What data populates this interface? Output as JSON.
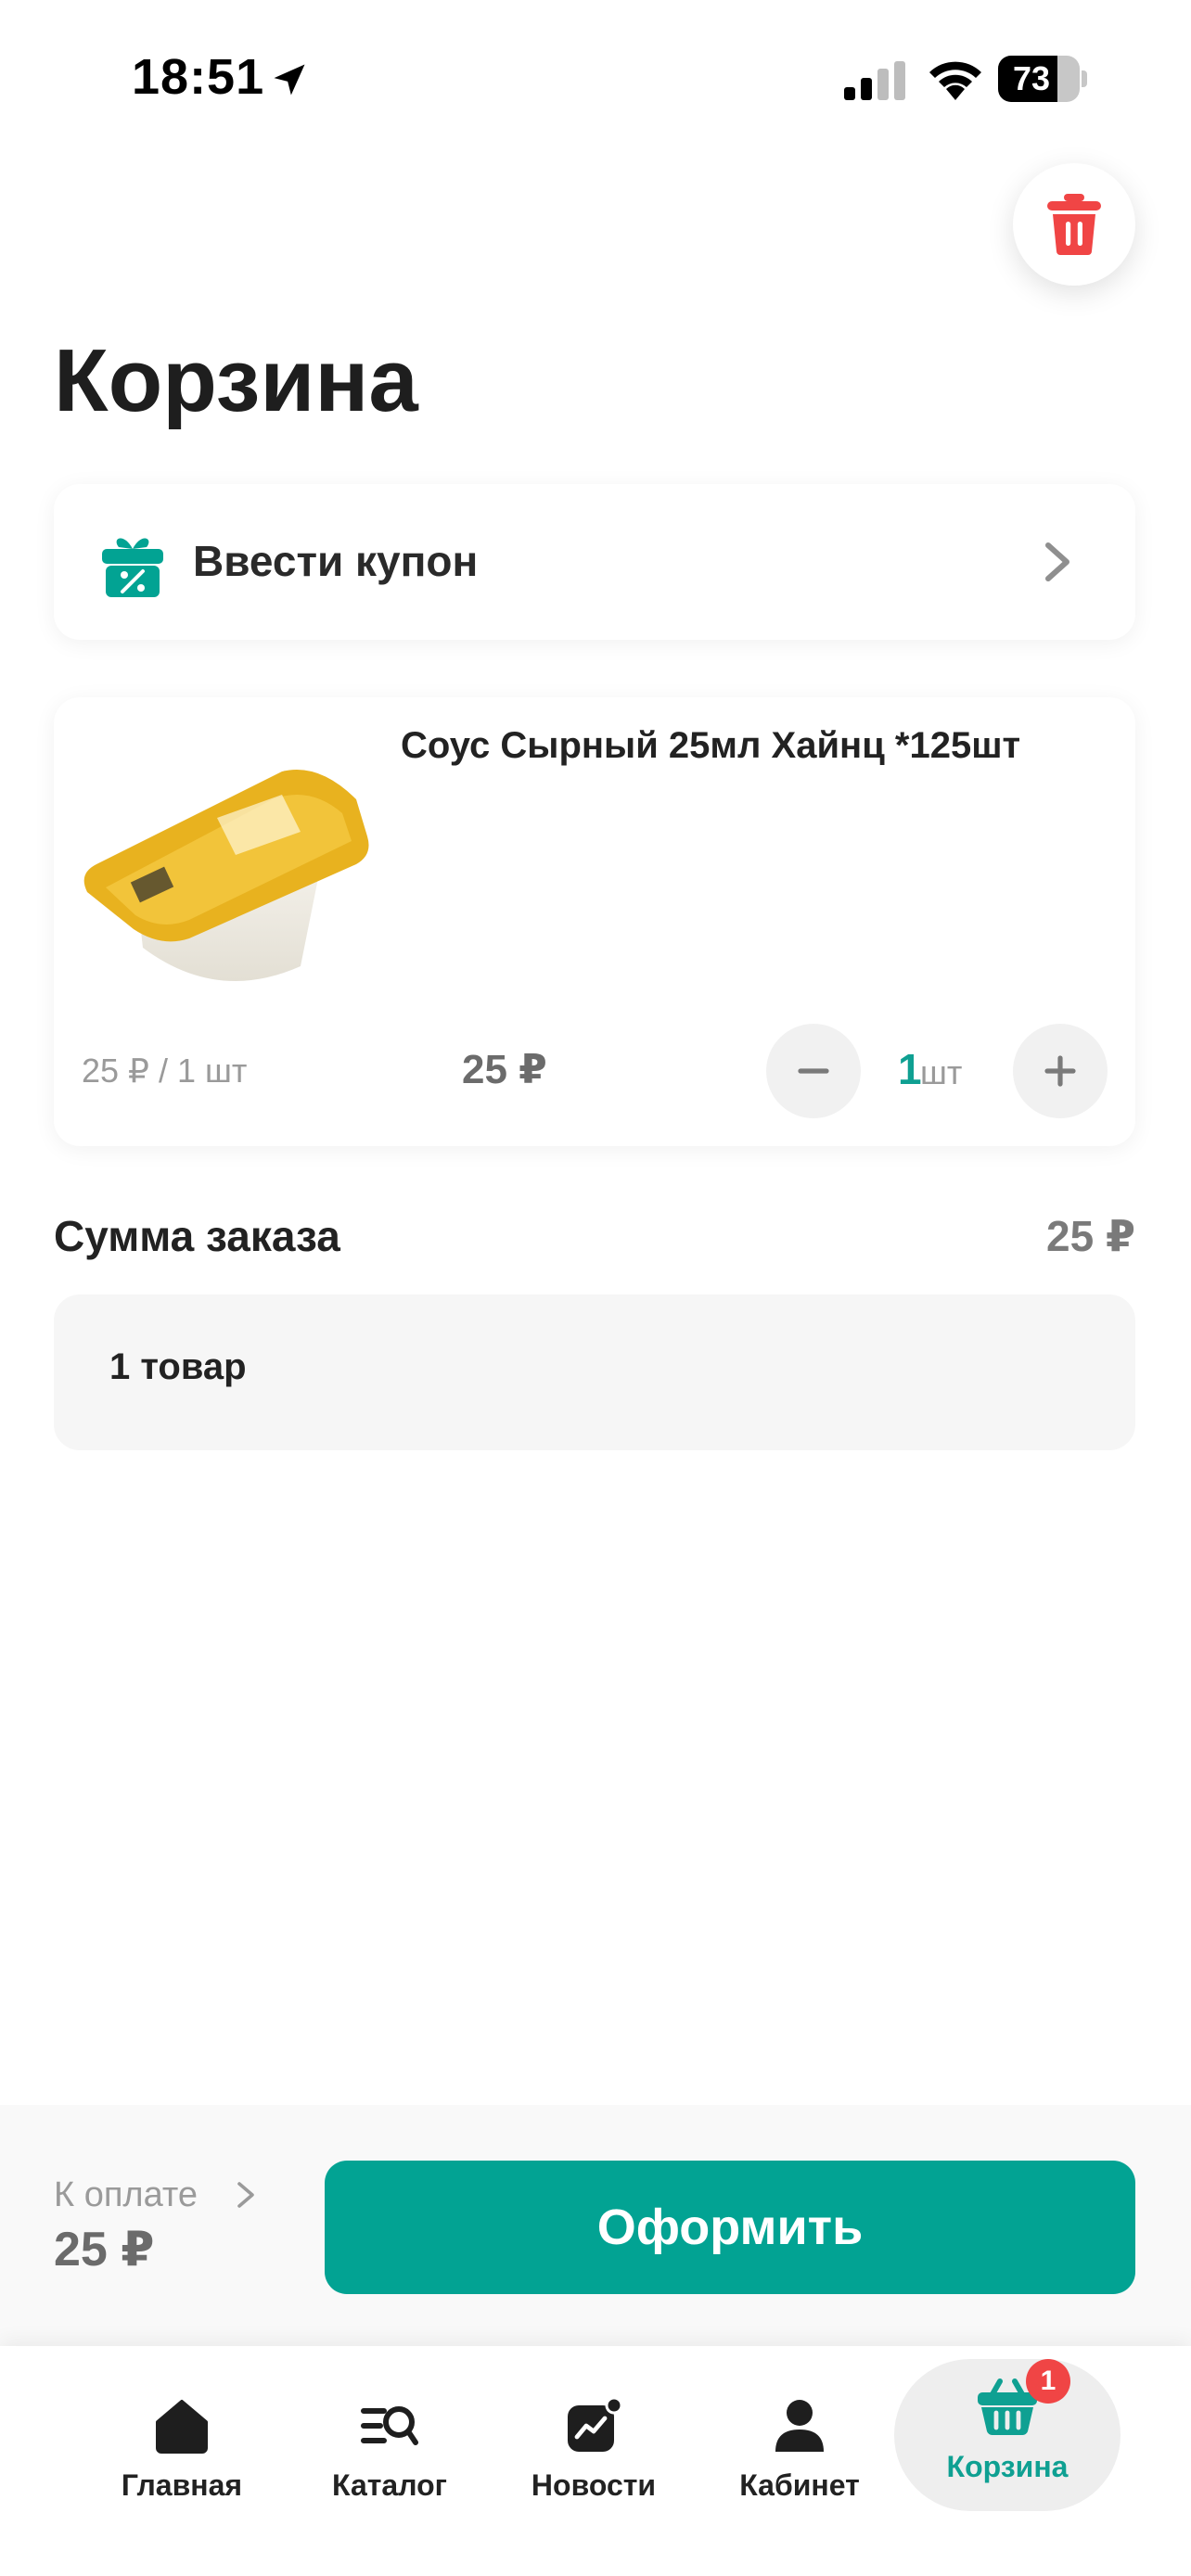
{
  "status_bar": {
    "time": "18:51",
    "battery": "73",
    "battery_level": 0.73
  },
  "header": {
    "title": "Корзина"
  },
  "coupon": {
    "label": "Ввести купон"
  },
  "cart": {
    "items": [
      {
        "name": "Соус Сырный 25мл Хайнц *125шт",
        "unit_price": "25 ₽ / 1 шт",
        "price": "25 ₽",
        "quantity": "1",
        "quantity_unit": "шт",
        "image": "sauce-packet-heinz-cheese"
      }
    ]
  },
  "summary": {
    "label": "Сумма заказа",
    "value": "25 ₽",
    "items_count": "1 товар"
  },
  "checkout": {
    "label": "К оплате",
    "total": "25 ₽",
    "button": "Оформить"
  },
  "tabs": [
    {
      "label": "Главная",
      "icon": "home-icon"
    },
    {
      "label": "Каталог",
      "icon": "catalog-search-icon"
    },
    {
      "label": "Новости",
      "icon": "news-chart-icon"
    },
    {
      "label": "Кабинет",
      "icon": "profile-icon"
    },
    {
      "label": "Корзина",
      "icon": "basket-icon",
      "active": true,
      "badge": "1"
    }
  ],
  "colors": {
    "accent": "#02a393",
    "danger": "#f04545",
    "text": "#1e1e1e"
  }
}
